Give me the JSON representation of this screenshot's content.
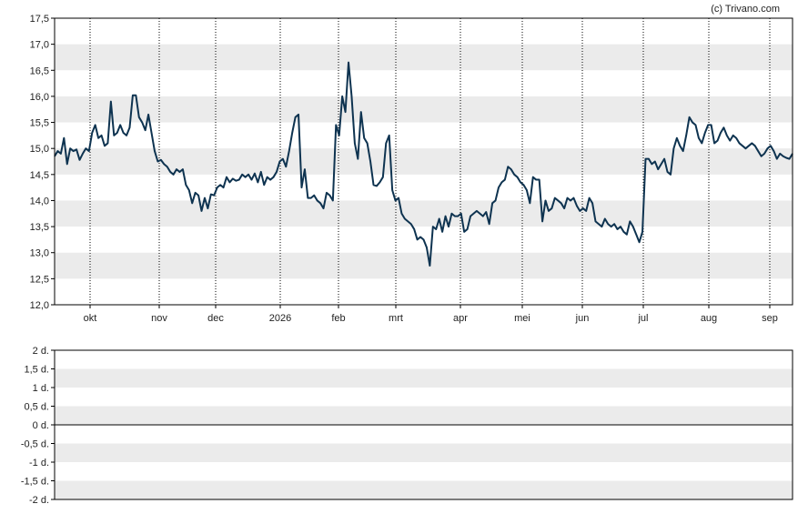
{
  "credit": "(c) Trivano.com",
  "colors": {
    "line": "#0e3350",
    "band": "#ebebeb",
    "background": "#ffffff",
    "axis": "#000000",
    "gridline": "#000000"
  },
  "chart_data": [
    {
      "type": "line",
      "title": "",
      "xlabel": "",
      "ylabel": "",
      "ylim": [
        12.0,
        17.5
      ],
      "y_ticks": [
        "12,0",
        "12,5",
        "13,0",
        "13,5",
        "14,0",
        "14,5",
        "15,0",
        "15,5",
        "16,0",
        "16,5",
        "17,0",
        "17,5"
      ],
      "x_ticks": [
        "okt",
        "nov",
        "dec",
        "2026",
        "feb",
        "mrt",
        "apr",
        "mei",
        "jun",
        "jul",
        "aug",
        "sep"
      ],
      "grid": "vertical dotted lines at month ticks; alternating horizontal bands",
      "series": [
        {
          "values": [
            14.85,
            14.95,
            14.9,
            15.2,
            14.7,
            15.0,
            14.95,
            14.98,
            14.78,
            14.9,
            15.0,
            14.95,
            15.3,
            15.45,
            15.2,
            15.25,
            15.05,
            15.1,
            15.9,
            15.25,
            15.3,
            15.45,
            15.3,
            15.25,
            15.4,
            16.02,
            16.02,
            15.6,
            15.5,
            15.35,
            15.65,
            15.3,
            14.95,
            14.75,
            14.78,
            14.7,
            14.65,
            14.55,
            14.5,
            14.6,
            14.55,
            14.6,
            14.3,
            14.2,
            13.95,
            14.15,
            14.1,
            13.8,
            14.05,
            13.85,
            14.12,
            14.1,
            14.25,
            14.3,
            14.25,
            14.45,
            14.35,
            14.42,
            14.38,
            14.4,
            14.5,
            14.45,
            14.5,
            14.4,
            14.52,
            14.35,
            14.55,
            14.3,
            14.45,
            14.4,
            14.45,
            14.55,
            14.75,
            14.8,
            14.65,
            14.95,
            15.3,
            15.6,
            15.65,
            14.25,
            14.6,
            14.05,
            14.05,
            14.1,
            14.0,
            13.95,
            13.85,
            14.15,
            14.1,
            14.0,
            15.45,
            15.25,
            16.0,
            15.7,
            16.65,
            16.0,
            15.1,
            14.8,
            15.7,
            15.2,
            15.1,
            14.75,
            14.3,
            14.28,
            14.35,
            14.45,
            15.1,
            15.25,
            14.2,
            14.0,
            14.05,
            13.75,
            13.65,
            13.6,
            13.55,
            13.45,
            13.25,
            13.3,
            13.25,
            13.1,
            12.75,
            13.5,
            13.45,
            13.65,
            13.4,
            13.7,
            13.5,
            13.75,
            13.7,
            13.7,
            13.75,
            13.4,
            13.45,
            13.7,
            13.75,
            13.8,
            13.75,
            13.7,
            13.78,
            13.55,
            13.95,
            14.0,
            14.25,
            14.35,
            14.4,
            14.65,
            14.6,
            14.5,
            14.45,
            14.35,
            14.3,
            14.2,
            13.95,
            14.45,
            14.4,
            14.4,
            13.6,
            14.0,
            13.8,
            13.85,
            14.05,
            14.0,
            13.95,
            13.85,
            14.05,
            14.0,
            14.05,
            13.9,
            13.8,
            13.85,
            13.8,
            14.05,
            13.95,
            13.6,
            13.55,
            13.5,
            13.65,
            13.55,
            13.5,
            13.55,
            13.45,
            13.5,
            13.4,
            13.35,
            13.6,
            13.5,
            13.35,
            13.2,
            13.4,
            14.8,
            14.8,
            14.7,
            14.75,
            14.6,
            14.7,
            14.8,
            14.55,
            14.5,
            15.0,
            15.2,
            15.05,
            14.95,
            15.25,
            15.6,
            15.5,
            15.45,
            15.2,
            15.1,
            15.3,
            15.45,
            15.45,
            15.1,
            15.15,
            15.3,
            15.4,
            15.25,
            15.15,
            15.25,
            15.2,
            15.1,
            15.05,
            15.0,
            15.05,
            15.1,
            15.05,
            14.95,
            14.85,
            14.9,
            15.0,
            15.05,
            14.95,
            14.8,
            14.9,
            14.85,
            14.82,
            14.8,
            14.9
          ]
        }
      ]
    },
    {
      "type": "line",
      "title": "",
      "xlabel": "",
      "ylabel": "",
      "ylim": [
        -2,
        2
      ],
      "y_ticks": [
        "2 d.",
        "1,5 d.",
        "1 d.",
        "0,5 d.",
        "0 d.",
        "-0,5 d.",
        "-1 d.",
        "-1,5 d.",
        "-2 d."
      ],
      "zero_line": true,
      "series": []
    }
  ]
}
